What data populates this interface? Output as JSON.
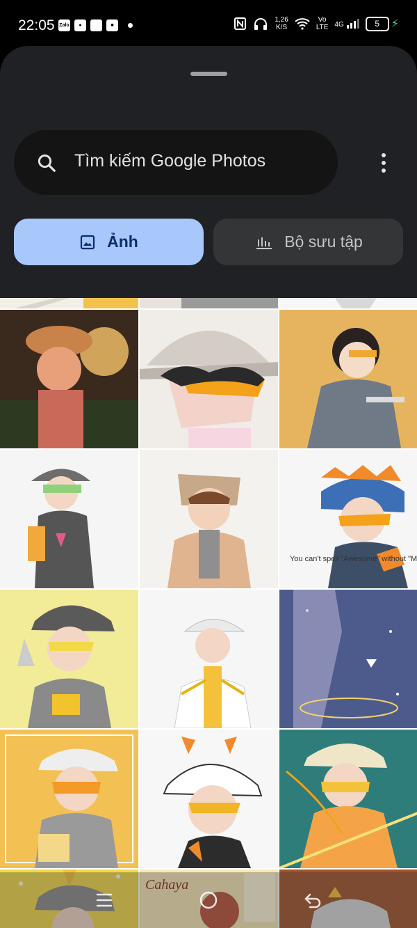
{
  "status_bar": {
    "time": "22:05",
    "left_icons": [
      "Zalo",
      "chat-icon",
      "app-icon",
      "office-icon"
    ],
    "speed_value": "1,26",
    "speed_unit": "K/S",
    "network_top": "Vo",
    "network_bottom": "LTE",
    "signal_label": "4G",
    "battery": "5"
  },
  "search": {
    "placeholder": "Tìm kiếm Google Photos"
  },
  "tabs": [
    {
      "label": "Ảnh",
      "icon": "image-icon",
      "active": true
    },
    {
      "label": "Bộ sưu tập",
      "icon": "bar-chart-icon",
      "active": false
    }
  ],
  "grid_captions": {
    "row2_col3": "You can't spell \"Awesome\" without \"Me\"",
    "row5_col2": "Cahaya"
  },
  "colors": {
    "accent_tab": "#a8c7fa",
    "sheet_bg": "#202124",
    "search_bg": "#141414"
  }
}
